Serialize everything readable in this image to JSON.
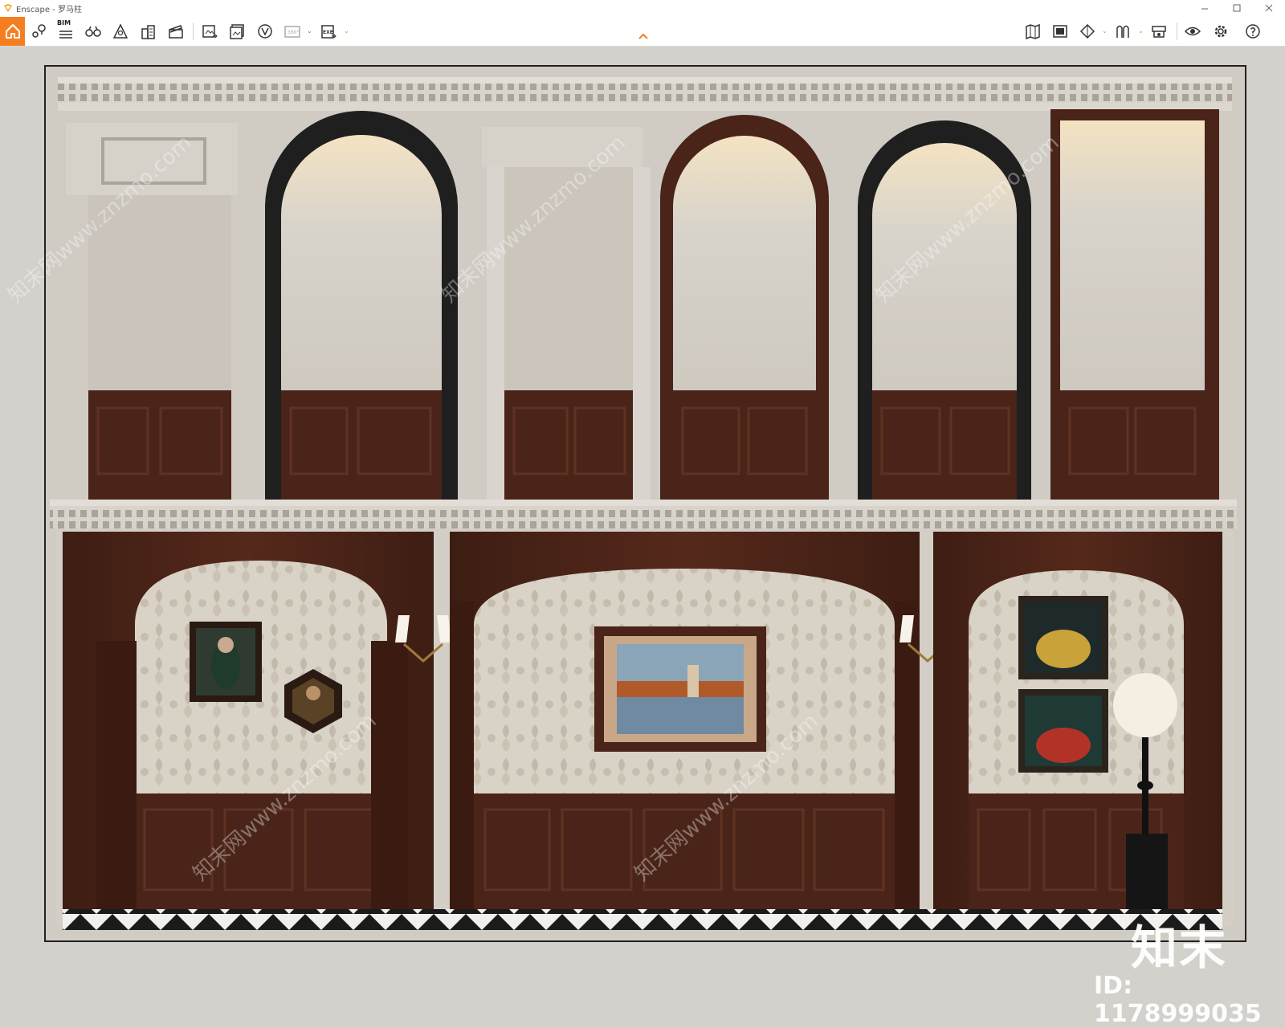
{
  "window": {
    "title": "Enscape - 罗马柱"
  },
  "toolbar": {
    "home_icon": "home-icon",
    "left_icons": [
      "pin-marker-icon",
      "bim-icon",
      "binoculars-icon",
      "perspective-icon",
      "buildings-icon",
      "clapper-icon",
      "export-image-icon",
      "batch-render-icon",
      "video-icon",
      "panorama-360-icon",
      "exe-export-icon"
    ],
    "right_icons": [
      "map-icon",
      "asset-library-icon",
      "cube-view-icon",
      "visual-settings-icon",
      "material-editor-icon",
      "view-eye-icon",
      "settings-gear-icon",
      "help-icon"
    ],
    "bim_label": "BIM",
    "panorama_label": "360°",
    "exe_label": "EXE",
    "accent_color": "#f57f20"
  },
  "render": {
    "wall_color": "#c9c3b6",
    "wood_color": "#4a2418",
    "watermark_site": "知末网www.znzmo.com"
  },
  "watermark": {
    "logo_text": "知末",
    "id_text": "ID: 1178999035"
  }
}
